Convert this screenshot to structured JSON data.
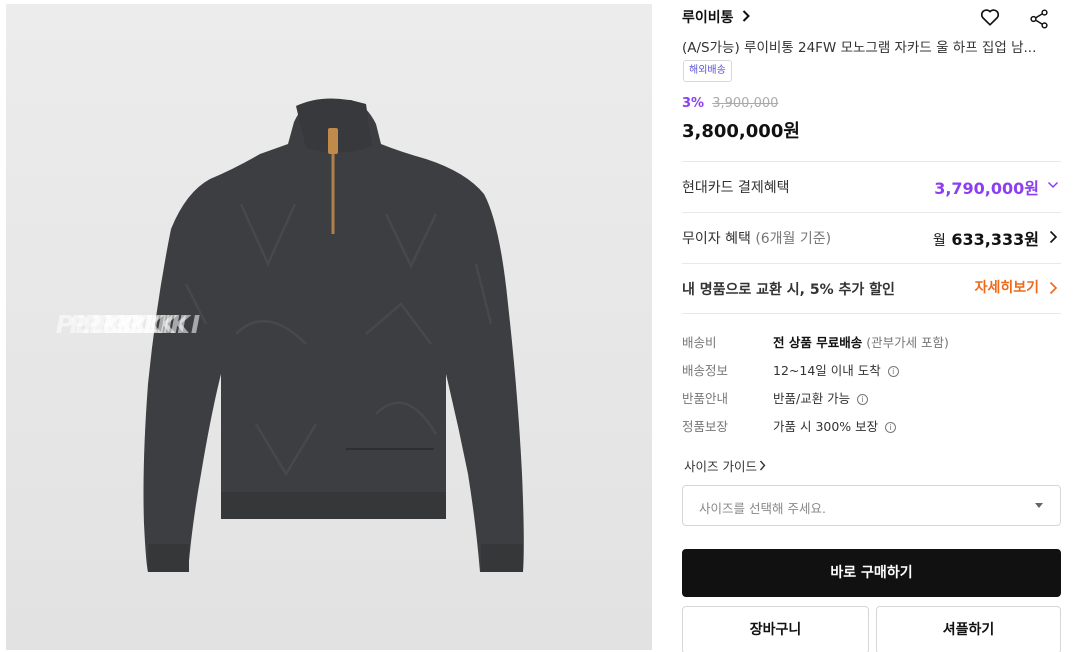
{
  "product_image": {
    "alt": "charcoal monogram jacquard half-zip sweater",
    "watermark": [
      "PLIKI",
      "PLIKI",
      "PLIKI",
      "PLIKI",
      "PLIKI",
      "PLIKI"
    ]
  },
  "header": {
    "brand": "루이비통",
    "brand_chevron_icon": "chevron-right-icon",
    "wishlist_icon": "heart-icon",
    "share_icon": "share-icon"
  },
  "product": {
    "title": "(A/S가능) 루이비통 24FW 모노그램 자카드 울 하프 집업 남...",
    "badge": "해외배송",
    "discount": "3%",
    "original_price": "3,900,000",
    "price": "3,800,000원"
  },
  "benefits": {
    "card_label": "현대카드 결제혜택",
    "card_price": "3,790,000원",
    "installment_label": "무이자 혜택",
    "installment_note": "(6개월 기준)",
    "installment_prefix": "월",
    "installment_amount": "633,333원",
    "trade_in_text": "내 명품으로 교환 시, 5% 추가 할인",
    "trade_in_link": "자세히보기"
  },
  "shipping": {
    "rows": [
      {
        "key": "배송비",
        "value": "전 상품 무료배송",
        "note": "(관부가세 포함)"
      },
      {
        "key": "배송정보",
        "value": "12~14일 이내 도착"
      },
      {
        "key": "반품안내",
        "value": "반품/교환 가능"
      },
      {
        "key": "정품보장",
        "value": "가품 시 300% 보장"
      }
    ],
    "info_icon": "i"
  },
  "size": {
    "guide_label": "사이즈 가이드",
    "placeholder": "사이즈를 선택해 주세요."
  },
  "actions": {
    "buy": "바로 구매하기",
    "cart": "장바구니",
    "gift": "셔플하기"
  },
  "colors": {
    "accent_purple": "#8b3ff0",
    "accent_orange": "#ee6a1a",
    "primary_button": "#111111"
  }
}
